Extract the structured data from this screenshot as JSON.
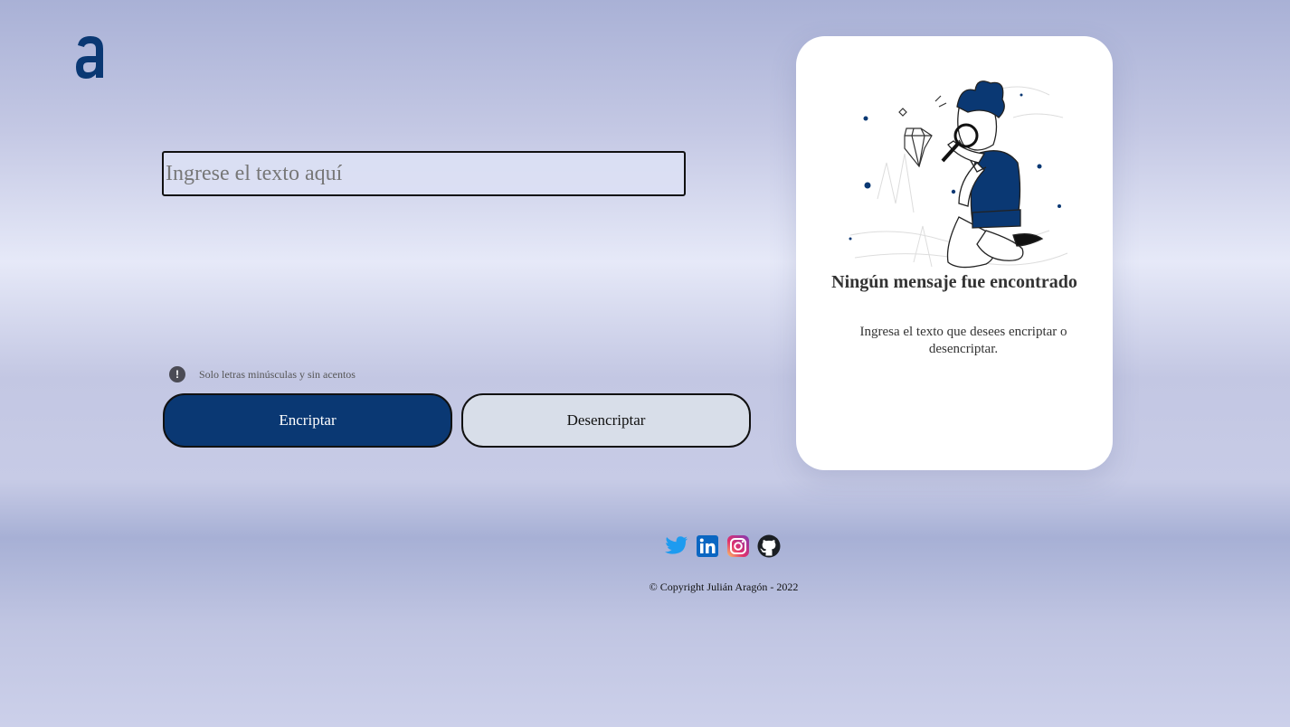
{
  "brand": {
    "logo_icon": "alura-a-logo",
    "color": "#0a3873"
  },
  "input": {
    "placeholder": "Ingrese el texto aquí",
    "value": ""
  },
  "hint": {
    "icon": "exclamation-circle-icon",
    "text": "Solo letras minúsculas y sin acentos"
  },
  "buttons": {
    "encrypt_label": "Encriptar",
    "decrypt_label": "Desencriptar"
  },
  "result_card": {
    "illustration": "person-with-magnifying-glass",
    "title": "Ningún mensaje fue encontrado",
    "subtitle": "Ingresa el texto que desees encriptar o desencriptar."
  },
  "footer": {
    "social_icons": [
      "twitter-icon",
      "linkedin-icon",
      "instagram-icon",
      "github-icon"
    ],
    "copyright": "© Copyright Julián Aragón - 2022"
  }
}
